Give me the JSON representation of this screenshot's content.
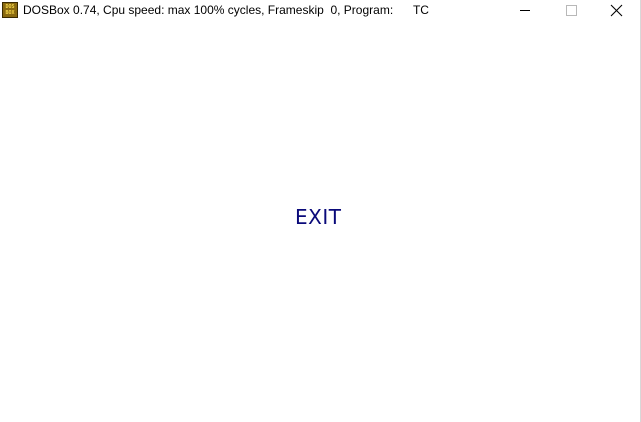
{
  "window": {
    "icon_label": "DOS BOX",
    "title": "DOSBox 0.74, Cpu speed: max 100% cycles, Frameskip  0, Program:      TC",
    "controls": {
      "minimize": "minimize-icon",
      "maximize": "maximize-icon",
      "close": "close-icon"
    }
  },
  "content": {
    "exit_label": "EXIT"
  },
  "colors": {
    "exit_text": "#0a0a7a",
    "background": "#ffffff"
  }
}
